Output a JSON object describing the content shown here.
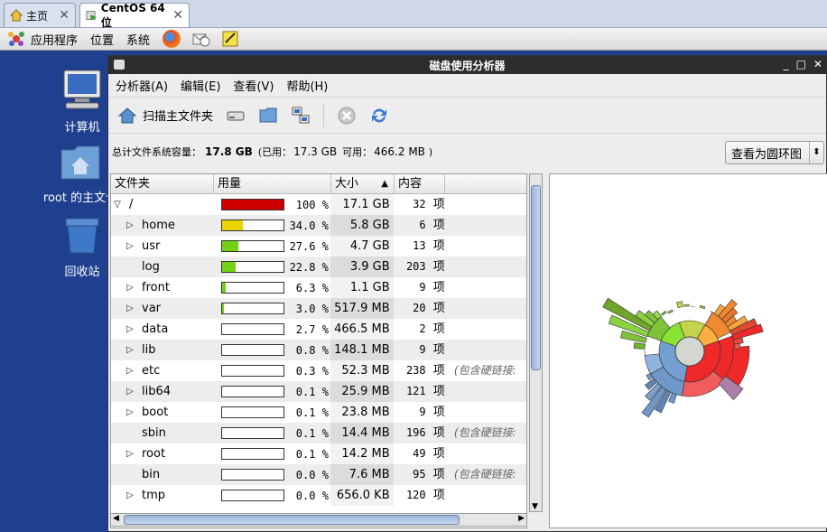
{
  "tabs": [
    {
      "label": "主页",
      "close": "✕"
    },
    {
      "label": "CentOS 64 位",
      "close": "✕"
    }
  ],
  "panel": {
    "menus": [
      "应用程序",
      "位置",
      "系统"
    ]
  },
  "desktop": [
    {
      "label": "计算机"
    },
    {
      "label": "root 的主文件"
    },
    {
      "label": "回收站"
    }
  ],
  "window": {
    "title": "磁盘使用分析器",
    "controls": [
      "_",
      "□",
      "✕"
    ],
    "menu": [
      "分析器(A)",
      "编辑(E)",
      "查看(V)",
      "帮助(H)"
    ],
    "toolbar": {
      "scan_home": "扫描主文件夹"
    },
    "info": {
      "prefix": "总计文件系统容量：",
      "total": "17.8 GB",
      "used_label": "(已用：",
      "used": "17.3 GB",
      "avail_label": "可用：",
      "avail": "466.2 MB",
      ")": ")"
    },
    "view_selector": "查看为圆环图",
    "columns": {
      "folder": "文件夹",
      "usage": "用量",
      "size": "大小",
      "contents": "内容"
    },
    "rows": [
      {
        "name": "/",
        "pct": "100 %",
        "fill": 1.0,
        "color": "#cc0000",
        "size": "17.1 GB",
        "items": "32",
        "unit": "项",
        "note": "",
        "expander": "open"
      },
      {
        "name": "home",
        "pct": "34.0 %",
        "fill": 0.34,
        "color": "#edd400",
        "size": "5.8 GB",
        "items": "6",
        "unit": "项",
        "note": "",
        "expander": "closed"
      },
      {
        "name": "usr",
        "pct": "27.6 %",
        "fill": 0.276,
        "color": "#73d216",
        "size": "4.7 GB",
        "items": "13",
        "unit": "项",
        "note": "",
        "expander": "closed"
      },
      {
        "name": "log",
        "pct": "22.8 %",
        "fill": 0.228,
        "color": "#73d216",
        "size": "3.9 GB",
        "items": "203",
        "unit": "项",
        "note": "",
        "expander": "none"
      },
      {
        "name": "front",
        "pct": "6.3 %",
        "fill": 0.063,
        "color": "#73d216",
        "size": "1.1 GB",
        "items": "9",
        "unit": "项",
        "note": "",
        "expander": "closed"
      },
      {
        "name": "var",
        "pct": "3.0 %",
        "fill": 0.03,
        "color": "#73d216",
        "size": "517.9 MB",
        "items": "20",
        "unit": "项",
        "note": "",
        "expander": "closed"
      },
      {
        "name": "data",
        "pct": "2.7 %",
        "fill": 0.0,
        "color": "#73d216",
        "size": "466.5 MB",
        "items": "2",
        "unit": "项",
        "note": "",
        "expander": "closed"
      },
      {
        "name": "lib",
        "pct": "0.8 %",
        "fill": 0.0,
        "color": "#73d216",
        "size": "148.1 MB",
        "items": "9",
        "unit": "项",
        "note": "",
        "expander": "closed"
      },
      {
        "name": "etc",
        "pct": "0.3 %",
        "fill": 0.0,
        "color": "#73d216",
        "size": "52.3 MB",
        "items": "238",
        "unit": "项",
        "note": "(包含硬链接:",
        "expander": "closed"
      },
      {
        "name": "lib64",
        "pct": "0.1 %",
        "fill": 0.0,
        "color": "#73d216",
        "size": "25.9 MB",
        "items": "121",
        "unit": "项",
        "note": "",
        "expander": "closed"
      },
      {
        "name": "boot",
        "pct": "0.1 %",
        "fill": 0.0,
        "color": "#73d216",
        "size": "23.8 MB",
        "items": "9",
        "unit": "项",
        "note": "",
        "expander": "closed"
      },
      {
        "name": "sbin",
        "pct": "0.1 %",
        "fill": 0.0,
        "color": "#73d216",
        "size": "14.4 MB",
        "items": "196",
        "unit": "项",
        "note": "(包含硬链接:",
        "expander": "none"
      },
      {
        "name": "root",
        "pct": "0.1 %",
        "fill": 0.0,
        "color": "#73d216",
        "size": "14.2 MB",
        "items": "49",
        "unit": "项",
        "note": "",
        "expander": "closed"
      },
      {
        "name": "bin",
        "pct": "0.0 %",
        "fill": 0.0,
        "color": "#73d216",
        "size": "7.6 MB",
        "items": "95",
        "unit": "项",
        "note": "(包含硬链接:",
        "expander": "none"
      },
      {
        "name": "tmp",
        "pct": "0.0 %",
        "fill": 0.0,
        "color": "#73d216",
        "size": "656.0 KB",
        "items": "120",
        "unit": "项",
        "note": "",
        "expander": "closed"
      }
    ],
    "ring_colors": {
      "center": "#d3d7cf",
      "red": "#ef2929",
      "blue": "#729fcf",
      "green": "#8ae234",
      "yellow": "#c4d34a",
      "orange": "#fcaf3e",
      "purple": "#ad7fa8"
    }
  }
}
